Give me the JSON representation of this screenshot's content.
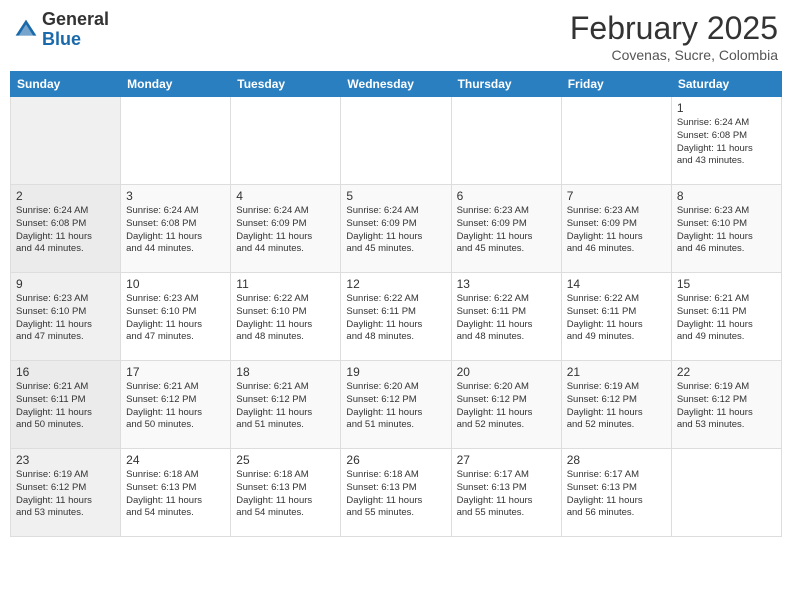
{
  "header": {
    "logo_general": "General",
    "logo_blue": "Blue",
    "month_year": "February 2025",
    "location": "Covenas, Sucre, Colombia"
  },
  "days_of_week": [
    "Sunday",
    "Monday",
    "Tuesday",
    "Wednesday",
    "Thursday",
    "Friday",
    "Saturday"
  ],
  "weeks": [
    {
      "days": [
        {
          "num": "",
          "info": ""
        },
        {
          "num": "",
          "info": ""
        },
        {
          "num": "",
          "info": ""
        },
        {
          "num": "",
          "info": ""
        },
        {
          "num": "",
          "info": ""
        },
        {
          "num": "",
          "info": ""
        },
        {
          "num": "1",
          "info": "Sunrise: 6:24 AM\nSunset: 6:08 PM\nDaylight: 11 hours\nand 43 minutes."
        }
      ]
    },
    {
      "days": [
        {
          "num": "2",
          "info": "Sunrise: 6:24 AM\nSunset: 6:08 PM\nDaylight: 11 hours\nand 44 minutes."
        },
        {
          "num": "3",
          "info": "Sunrise: 6:24 AM\nSunset: 6:08 PM\nDaylight: 11 hours\nand 44 minutes."
        },
        {
          "num": "4",
          "info": "Sunrise: 6:24 AM\nSunset: 6:09 PM\nDaylight: 11 hours\nand 44 minutes."
        },
        {
          "num": "5",
          "info": "Sunrise: 6:24 AM\nSunset: 6:09 PM\nDaylight: 11 hours\nand 45 minutes."
        },
        {
          "num": "6",
          "info": "Sunrise: 6:23 AM\nSunset: 6:09 PM\nDaylight: 11 hours\nand 45 minutes."
        },
        {
          "num": "7",
          "info": "Sunrise: 6:23 AM\nSunset: 6:09 PM\nDaylight: 11 hours\nand 46 minutes."
        },
        {
          "num": "8",
          "info": "Sunrise: 6:23 AM\nSunset: 6:10 PM\nDaylight: 11 hours\nand 46 minutes."
        }
      ]
    },
    {
      "days": [
        {
          "num": "9",
          "info": "Sunrise: 6:23 AM\nSunset: 6:10 PM\nDaylight: 11 hours\nand 47 minutes."
        },
        {
          "num": "10",
          "info": "Sunrise: 6:23 AM\nSunset: 6:10 PM\nDaylight: 11 hours\nand 47 minutes."
        },
        {
          "num": "11",
          "info": "Sunrise: 6:22 AM\nSunset: 6:10 PM\nDaylight: 11 hours\nand 48 minutes."
        },
        {
          "num": "12",
          "info": "Sunrise: 6:22 AM\nSunset: 6:11 PM\nDaylight: 11 hours\nand 48 minutes."
        },
        {
          "num": "13",
          "info": "Sunrise: 6:22 AM\nSunset: 6:11 PM\nDaylight: 11 hours\nand 48 minutes."
        },
        {
          "num": "14",
          "info": "Sunrise: 6:22 AM\nSunset: 6:11 PM\nDaylight: 11 hours\nand 49 minutes."
        },
        {
          "num": "15",
          "info": "Sunrise: 6:21 AM\nSunset: 6:11 PM\nDaylight: 11 hours\nand 49 minutes."
        }
      ]
    },
    {
      "days": [
        {
          "num": "16",
          "info": "Sunrise: 6:21 AM\nSunset: 6:11 PM\nDaylight: 11 hours\nand 50 minutes."
        },
        {
          "num": "17",
          "info": "Sunrise: 6:21 AM\nSunset: 6:12 PM\nDaylight: 11 hours\nand 50 minutes."
        },
        {
          "num": "18",
          "info": "Sunrise: 6:21 AM\nSunset: 6:12 PM\nDaylight: 11 hours\nand 51 minutes."
        },
        {
          "num": "19",
          "info": "Sunrise: 6:20 AM\nSunset: 6:12 PM\nDaylight: 11 hours\nand 51 minutes."
        },
        {
          "num": "20",
          "info": "Sunrise: 6:20 AM\nSunset: 6:12 PM\nDaylight: 11 hours\nand 52 minutes."
        },
        {
          "num": "21",
          "info": "Sunrise: 6:19 AM\nSunset: 6:12 PM\nDaylight: 11 hours\nand 52 minutes."
        },
        {
          "num": "22",
          "info": "Sunrise: 6:19 AM\nSunset: 6:12 PM\nDaylight: 11 hours\nand 53 minutes."
        }
      ]
    },
    {
      "days": [
        {
          "num": "23",
          "info": "Sunrise: 6:19 AM\nSunset: 6:12 PM\nDaylight: 11 hours\nand 53 minutes."
        },
        {
          "num": "24",
          "info": "Sunrise: 6:18 AM\nSunset: 6:13 PM\nDaylight: 11 hours\nand 54 minutes."
        },
        {
          "num": "25",
          "info": "Sunrise: 6:18 AM\nSunset: 6:13 PM\nDaylight: 11 hours\nand 54 minutes."
        },
        {
          "num": "26",
          "info": "Sunrise: 6:18 AM\nSunset: 6:13 PM\nDaylight: 11 hours\nand 55 minutes."
        },
        {
          "num": "27",
          "info": "Sunrise: 6:17 AM\nSunset: 6:13 PM\nDaylight: 11 hours\nand 55 minutes."
        },
        {
          "num": "28",
          "info": "Sunrise: 6:17 AM\nSunset: 6:13 PM\nDaylight: 11 hours\nand 56 minutes."
        },
        {
          "num": "",
          "info": ""
        }
      ]
    }
  ]
}
